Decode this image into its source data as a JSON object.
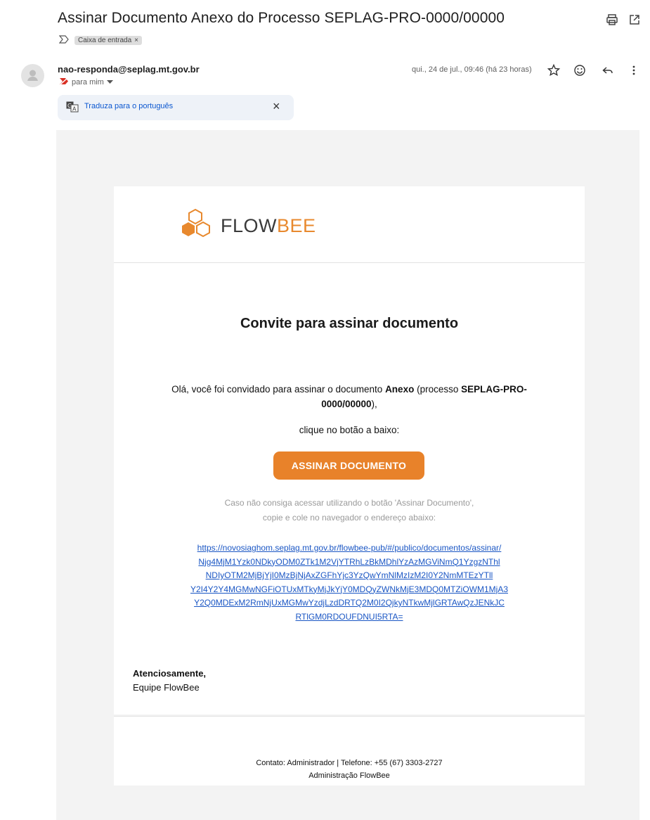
{
  "email": {
    "subject": "Assinar Documento Anexo do Processo SEPLAG-PRO-0000/00000",
    "label": "Caixa de entrada",
    "label_remove": "×",
    "sender": "nao-responda@seplag.mt.gov.br",
    "recipient": "para mim",
    "date": "qui., 24 de jul., 09:46 (há 23 horas)",
    "translate_text": "Traduza para o português",
    "translate_close": "×"
  },
  "body": {
    "brand_flow": "FLOW",
    "brand_bee": "BEE",
    "title": "Convite para assinar documento",
    "intro_1": "Olá, você foi convidado para assinar o documento ",
    "doc_name": "Anexo",
    "intro_2": " (processo ",
    "process": "SEPLAG-PRO-0000/00000",
    "intro_3": "),",
    "click_text": "clique no botão a baixo:",
    "button_label": "ASSINAR DOCUMENTO",
    "help_line_1": "Caso não consiga acessar utilizando o botão 'Assinar Documento',",
    "help_line_2": "copie e cole no navegador o endereço abaixo:",
    "link_lines": [
      "https://novosiaghom.seplag.mt.gov.br/flowbee-pub/#/publico/documentos/assinar/",
      "Njg4MjM1Yzk0NDkyODM0ZTk1M2VjYTRhLzBkMDhlYzAzMGViNmQ1YzgzNThl",
      "NDIyOTM2MjBjYjI0MzBjNjAxZGFhYjc3YzQwYmNlMzIzM2I0Y2NmMTEzYTll",
      "Y2I4Y2Y4MGMwNGFiOTUxMTkyMjJkYjY0MDQyZWNkMjE3MDQ0MTZiOWM1MjA3",
      "Y2Q0MDExM2RmNjUxMGMwYzdjLzdDRTQ2M0I2QjkyNTkwMjlGRTAwQzJENkJC",
      "RTlGM0RDOUFDNUI5RTA="
    ],
    "regards": "Atenciosamente,",
    "team": "Equipe FlowBee",
    "contact": "Contato: Administrador | Telefone: +55 (67) 3303-2727",
    "admin": "Administração FlowBee"
  },
  "colors": {
    "brand_orange": "#e8822a",
    "link_blue": "#1a56c4"
  },
  "icons": {
    "print": "printer-icon",
    "popout": "open-in-new-window-icon",
    "star": "star-icon",
    "emoji": "emoji-reaction-icon",
    "reply": "reply-icon",
    "more": "more-vert-icon",
    "translate": "translate-icon"
  }
}
